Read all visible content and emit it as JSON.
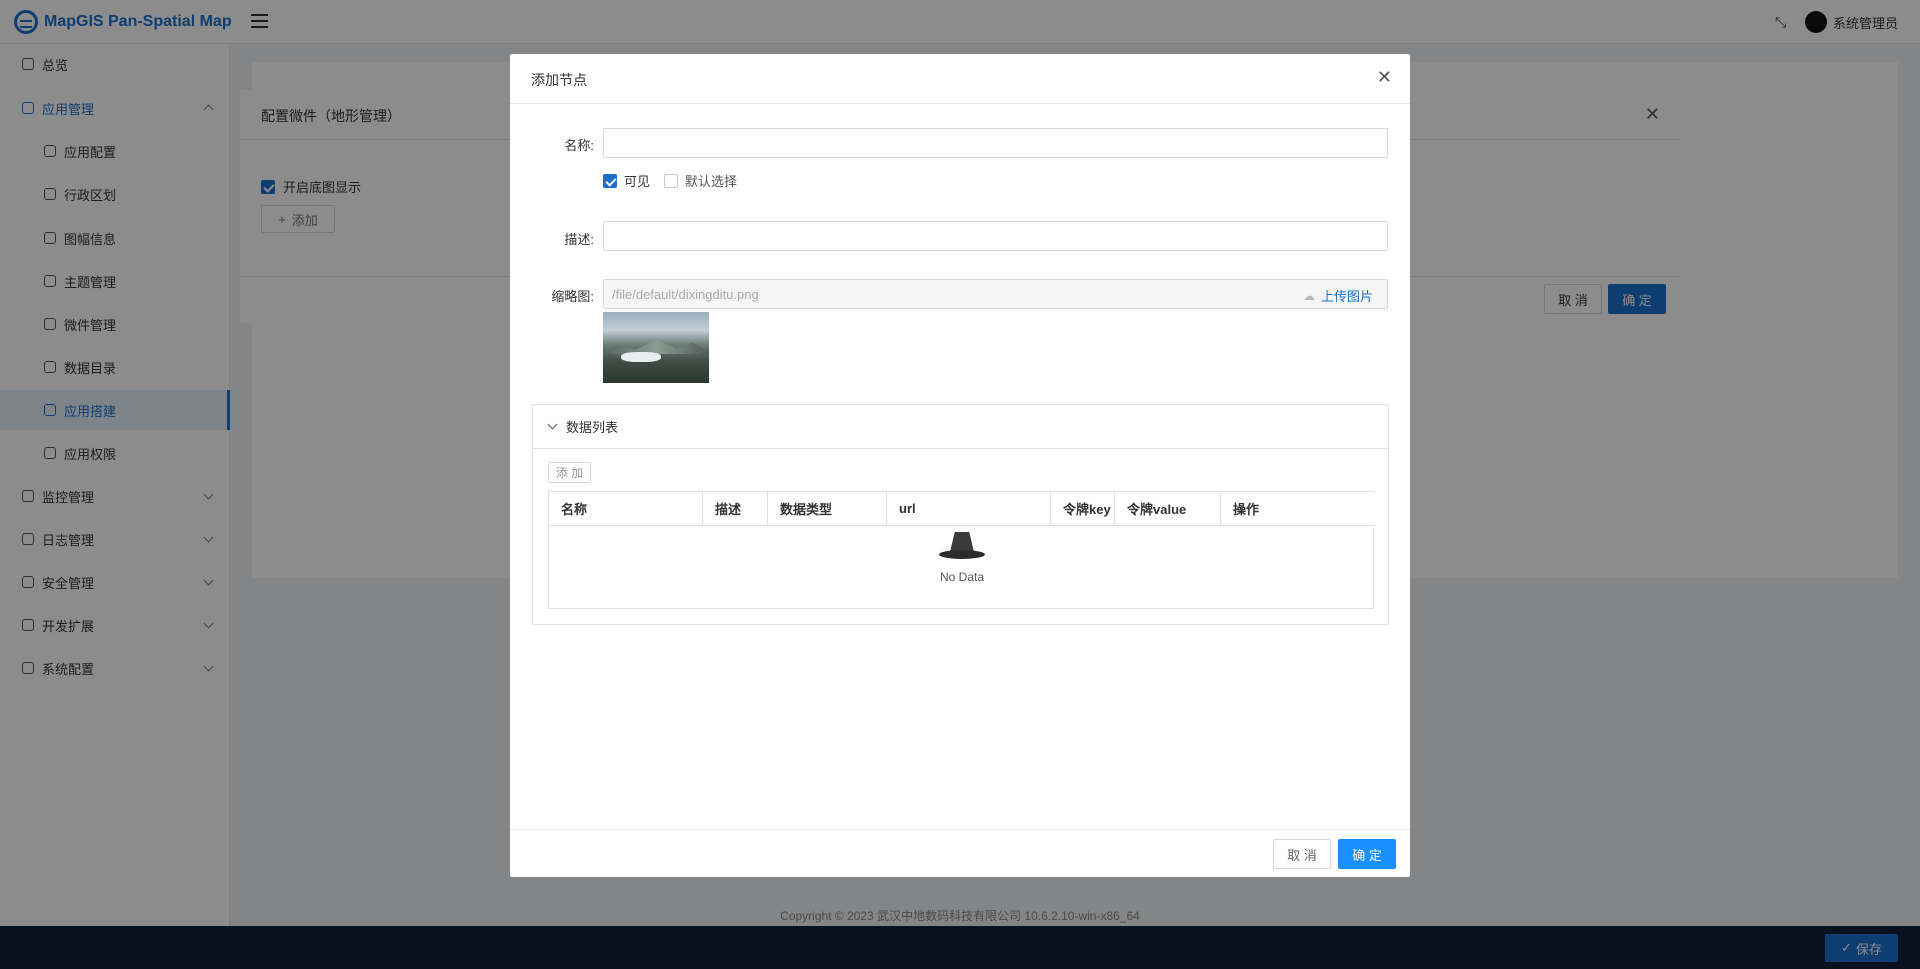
{
  "header": {
    "app_title": "MapGIS Pan-Spatial Map",
    "user_name": "系统管理员"
  },
  "sidebar": {
    "items": [
      {
        "label": "总览"
      },
      {
        "label": "应用管理"
      },
      {
        "label": "应用配置"
      },
      {
        "label": "行政区划"
      },
      {
        "label": "图幅信息"
      },
      {
        "label": "主题管理"
      },
      {
        "label": "微件管理"
      },
      {
        "label": "数据目录"
      },
      {
        "label": "应用搭建"
      },
      {
        "label": "应用权限"
      },
      {
        "label": "监控管理"
      },
      {
        "label": "日志管理"
      },
      {
        "label": "安全管理"
      },
      {
        "label": "开发扩展"
      },
      {
        "label": "系统配置"
      }
    ]
  },
  "background_dialog": {
    "title": "配置微件（地形管理）",
    "checkbox_label": "开启底图显示",
    "add_button": "添加",
    "cancel_button": "取 消",
    "ok_button": "确 定"
  },
  "footer": {
    "copyright": "Copyright © 2023 武汉中地数码科技有限公司 10.6.2.10-win-x86_64",
    "save_button": "保存"
  },
  "modal": {
    "title": "添加节点",
    "name_label": "名称:",
    "name_value": "",
    "visible_label": "可见",
    "visible_checked": true,
    "default_label": "默认选择",
    "default_checked": false,
    "desc_label": "描述:",
    "desc_value": "",
    "thumb_label": "缩略图:",
    "thumb_value": "/file/default/dixingditu.png",
    "upload_label": "上传图片",
    "section_title": "数据列表",
    "table_add_button": "添 加",
    "table_headers": [
      "名称",
      "描述",
      "数据类型",
      "url",
      "令牌key",
      "令牌value",
      "操作"
    ],
    "empty_text": "No Data",
    "cancel_button": "取 消",
    "ok_button": "确 定"
  },
  "colors": {
    "primary": "#1b6fcf",
    "bottom_bar": "#0e2238"
  }
}
